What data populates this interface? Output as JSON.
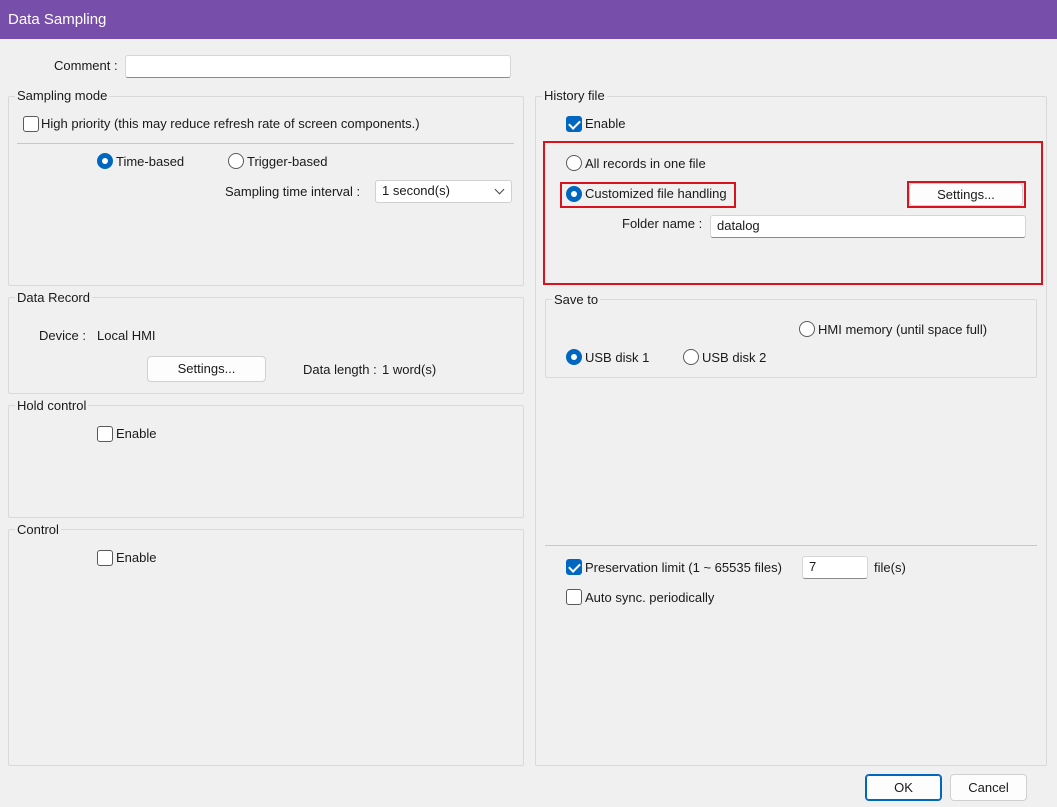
{
  "window": {
    "title": "Data Sampling"
  },
  "comment": {
    "label": "Comment :",
    "value": ""
  },
  "sampling_mode": {
    "title": "Sampling mode",
    "high_priority": {
      "label": "High priority (this may reduce refresh rate of screen components.)",
      "checked": false
    },
    "time_based": {
      "label": "Time-based",
      "selected": true
    },
    "trigger_based": {
      "label": "Trigger-based",
      "selected": false
    },
    "interval_label": "Sampling time interval :",
    "interval_value": "1 second(s)"
  },
  "data_record": {
    "title": "Data Record",
    "device_label": "Device :",
    "device_value": "Local HMI",
    "settings_button": "Settings...",
    "data_length_label": "Data length :",
    "data_length_value": "1 word(s)"
  },
  "hold_control": {
    "title": "Hold control",
    "enable_label": "Enable",
    "checked": false
  },
  "control": {
    "title": "Control",
    "enable_label": "Enable",
    "checked": false
  },
  "history_file": {
    "title": "History file",
    "enable_label": "Enable",
    "enable_checked": true,
    "all_records": {
      "label": "All records in one file",
      "selected": false
    },
    "customized": {
      "label": "Customized file handling",
      "selected": true
    },
    "settings_button": "Settings...",
    "folder_label": "Folder name :",
    "folder_value": "datalog"
  },
  "save_to": {
    "title": "Save to",
    "hmi_memory": {
      "label": "HMI memory (until space full)",
      "selected": false
    },
    "usb1": {
      "label": "USB disk 1",
      "selected": true
    },
    "usb2": {
      "label": "USB disk 2",
      "selected": false
    }
  },
  "preservation": {
    "label": "Preservation limit (1 ~ 65535 files)",
    "checked": true,
    "value": "7",
    "unit": "file(s)"
  },
  "auto_sync": {
    "label": "Auto sync. periodically",
    "checked": false
  },
  "footer": {
    "ok": "OK",
    "cancel": "Cancel"
  },
  "colors": {
    "title_bar": "#774eaa",
    "accent": "#0067c0",
    "highlight": "#d9131d"
  }
}
